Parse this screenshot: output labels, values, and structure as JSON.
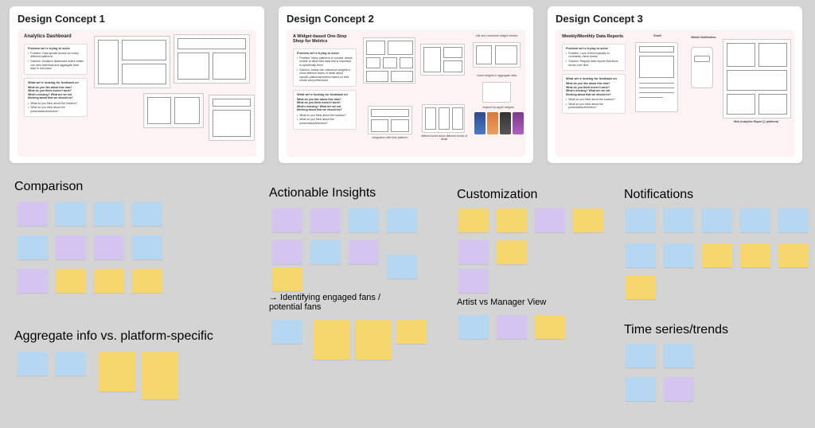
{
  "concepts": [
    {
      "title": "Design Concept 1",
      "panel_title": "Analytics Dashboard",
      "problem_box_head": "Problem we're trying to solve",
      "problem_bullets": [
        "Problem: Data spread across too many different platforms",
        "Solution: Analytics dashboard where artists can view individual and aggregate level data in one place"
      ],
      "feedback_head": "What we're looking for feedback on",
      "feedback_lines": [
        "What do you like about this idea?",
        "What do you think doesn't work?",
        "What's missing? What are we not thinking about that we should be?"
      ],
      "feedback_extra": [
        "What do you think about the function?",
        "What do you think about the presentation/interface?"
      ]
    },
    {
      "title": "Design Concept 2",
      "panel_title": "A Widget-based One-Stop Shop for Metrics",
      "problem_box_head": "Problem we're trying to solve",
      "problem_bullets": [
        "Problem: Many platforms to monitor, artists unable to tailor/view data that is important to specifically them",
        "Solution: Artists can customize widgets to show different levels of detail about specific platforms/metrics based on their needs and preferences"
      ],
      "feedback_head": "What we're looking for feedback on",
      "feedback_lines": [
        "What do you like about this idea?",
        "What do you think doesn't work?",
        "What's missing? What are we not thinking about that we should be?"
      ],
      "feedback_extra": [
        "What do you think about the function?",
        "What do you think about the presentation/interface?"
      ],
      "captions": {
        "top_right": "edit and customize widget metrics",
        "mid_right": "smart widgets to aggregate data",
        "inspo": "inspired by Apple widgets",
        "int": "integration with time platform",
        "levels": "different sizes show different levels of detail"
      }
    },
    {
      "title": "Design Concept 3",
      "panel_title": "Weekly/Monthly Data Reports",
      "problem_box_head": "Problem we're trying to solve",
      "problem_bullets": [
        "Problem: Lack of time/capacity to constantly check trends",
        "Solution: Regular data reports that show trends over time"
      ],
      "feedback_head": "What we're looking for feedback on",
      "feedback_lines": [
        "What do you like about this idea?",
        "What do you think doesn't work?",
        "What's missing? What are we not thinking about that we should be?"
      ],
      "feedback_extra": [
        "What do you think about the function?",
        "What do you think about the presentation/interface?"
      ],
      "captions": {
        "email": "Email",
        "mobile": "Mobile Notification",
        "footer": "Web Analytics Report (1 platform)"
      }
    }
  ],
  "clusters": {
    "comparison": "Comparison",
    "aggregate": "Aggregate info vs. platform-specific",
    "actionable": "Actionable Insights",
    "actionable_sub": "→ Identifying engaged fans / potential fans",
    "customization": "Customization",
    "artist_manager": "Artist vs Manager View",
    "notifications": "Notifications",
    "timeseries": "Time series/trends"
  }
}
